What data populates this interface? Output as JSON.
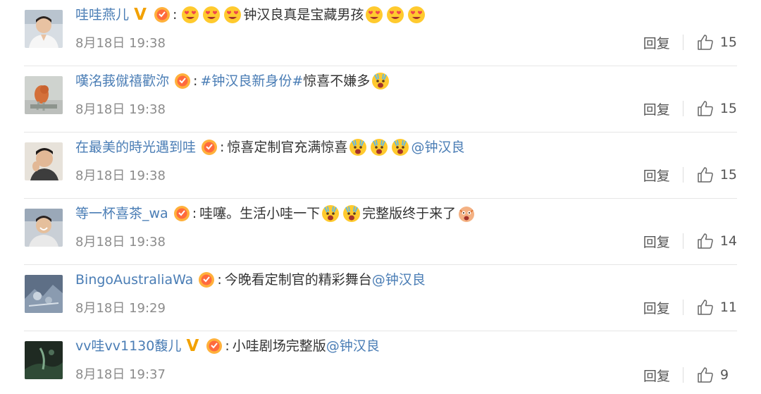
{
  "comments": [
    {
      "username": "哇哇燕儿",
      "verified": true,
      "verified_badge": "V",
      "colon": ":",
      "segments": [
        {
          "type": "emoji",
          "name": "heart-eyes-emoji"
        },
        {
          "type": "emoji",
          "name": "heart-eyes-emoji"
        },
        {
          "type": "emoji",
          "name": "heart-eyes-emoji"
        },
        {
          "type": "text",
          "value": "钟汉良真是宝藏男孩"
        },
        {
          "type": "emoji",
          "name": "heart-eyes-emoji"
        },
        {
          "type": "emoji",
          "name": "heart-eyes-emoji"
        },
        {
          "type": "emoji",
          "name": "heart-eyes-emoji"
        }
      ],
      "time": "8月18日 19:38",
      "reply_label": "回复",
      "likes": "15",
      "avatar": "avatar-man-white-shirt"
    },
    {
      "username": "嘆洺莪僦禧歡沵",
      "verified": false,
      "colon": ":",
      "segments": [
        {
          "type": "link",
          "value": "#钟汉良新身份#"
        },
        {
          "type": "text",
          "value": " 惊喜不嫌多"
        },
        {
          "type": "emoji",
          "name": "surprised-emoji"
        }
      ],
      "time": "8月18日 19:38",
      "reply_label": "回复",
      "likes": "15",
      "avatar": "avatar-orange-bird"
    },
    {
      "username": "在最美的時光遇到哇",
      "verified": false,
      "colon": ":",
      "segments": [
        {
          "type": "text",
          "value": "惊喜定制官充满惊喜"
        },
        {
          "type": "emoji",
          "name": "surprised-emoji"
        },
        {
          "type": "emoji",
          "name": "surprised-emoji"
        },
        {
          "type": "emoji",
          "name": "surprised-emoji"
        },
        {
          "type": "link",
          "value": "@钟汉良"
        }
      ],
      "time": "8月18日 19:38",
      "reply_label": "回复",
      "likes": "15",
      "avatar": "avatar-man-thinking"
    },
    {
      "username": "等一杯喜茶_wa",
      "verified": false,
      "colon": ":",
      "segments": [
        {
          "type": "text",
          "value": "哇噻。生活小哇一下"
        },
        {
          "type": "emoji",
          "name": "surprised-emoji"
        },
        {
          "type": "emoji",
          "name": "surprised-emoji"
        },
        {
          "type": "text",
          "value": "完整版终于来了"
        },
        {
          "type": "emoji",
          "name": "shocked-face-emoji"
        }
      ],
      "time": "8月18日 19:38",
      "reply_label": "回复",
      "likes": "14",
      "avatar": "avatar-man-smiling"
    },
    {
      "username": "BingoAustraliaWa",
      "verified": false,
      "colon": ":",
      "segments": [
        {
          "type": "text",
          "value": "今晚看定制官的精彩舞台"
        },
        {
          "type": "link",
          "value": "@钟汉良"
        }
      ],
      "time": "8月18日 19:29",
      "reply_label": "回复",
      "likes": "11",
      "avatar": "avatar-bluegray-photo"
    },
    {
      "username": "vv哇vv1130馥儿",
      "verified": true,
      "verified_badge": "V",
      "colon": ":",
      "segments": [
        {
          "type": "text",
          "value": "小哇剧场完整版"
        },
        {
          "type": "link",
          "value": "@钟汉良"
        }
      ],
      "time": "8月18日 19:37",
      "reply_label": "回复",
      "likes": "9",
      "avatar": "avatar-dark-green"
    }
  ],
  "colors": {
    "username": "#4a7db5",
    "text": "#333333",
    "meta": "#8c8c8c",
    "separator": "#e6e6e6",
    "verified": "#f2a100"
  }
}
